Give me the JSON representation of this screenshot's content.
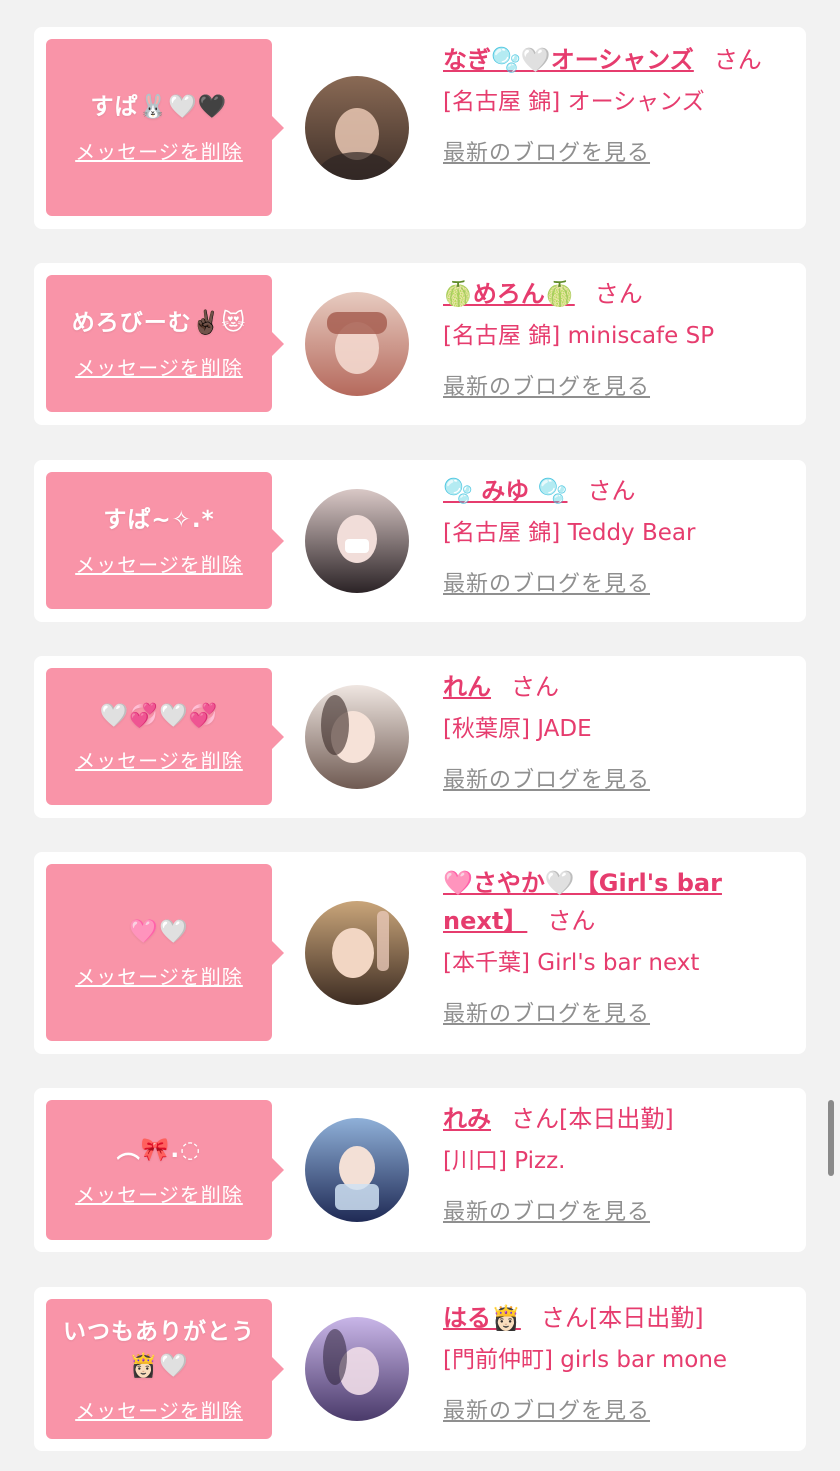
{
  "delete_label": "メッセージを削除",
  "blog_label": "最新のブログを見る",
  "honorific": "さん",
  "colors": {
    "page_bg": "#f2f2f2",
    "card_bg": "#ffffff",
    "bubble_bg": "#f994a8",
    "name_pink": "#e63c6e",
    "link_gray": "#8f8f8f"
  },
  "cards": [
    {
      "message": "すぱ🐰🤍🖤",
      "name": "なぎ🫧🤍オーシャンズ",
      "status": "",
      "shop": "[名古屋 錦] オーシャンズ",
      "avatar_icon": "avatar-photo-icon",
      "avatar_colors": [
        "#8a6a55",
        "#3e2f28"
      ]
    },
    {
      "message": "めろびーむ✌🏿😻",
      "name": "🍈めろん🍈",
      "status": "",
      "shop": "[名古屋 錦] miniscafe SP",
      "avatar_icon": "avatar-photo-icon",
      "avatar_colors": [
        "#e7cbc0",
        "#b5695c"
      ]
    },
    {
      "message": "すぱ~✧.*",
      "name": "🫧 みゆ 🫧",
      "status": "",
      "shop": "[名古屋 錦] Teddy Bear",
      "avatar_icon": "avatar-photo-icon",
      "avatar_colors": [
        "#d9c8c6",
        "#2b2326"
      ]
    },
    {
      "message": "🤍💞🤍💞",
      "name": "れん",
      "status": "",
      "shop": "[秋葉原] JADE",
      "avatar_icon": "avatar-photo-icon",
      "avatar_colors": [
        "#efe6e1",
        "#6f5a52"
      ]
    },
    {
      "message": "🩷🤍",
      "name": "🩷さやか🤍【Girl's bar next】",
      "status": "",
      "shop": "[本千葉] Girl's bar next",
      "avatar_icon": "avatar-photo-icon",
      "avatar_colors": [
        "#c9a57a",
        "#3d2c22"
      ]
    },
    {
      "message": "︵🎀.◌",
      "name": "れみ",
      "status": "[本日出勤]",
      "shop": "[川口] Pizz.",
      "avatar_icon": "avatar-photo-icon",
      "avatar_colors": [
        "#8fb0d8",
        "#1f2a55"
      ]
    },
    {
      "message": "いつもありがとう👸🏻🤍",
      "name": "はる👸🏻",
      "status": "[本日出勤]",
      "shop": "[門前仲町] girls bar mone",
      "avatar_icon": "avatar-photo-icon",
      "avatar_colors": [
        "#c9b6e8",
        "#4a3a6a"
      ]
    }
  ]
}
